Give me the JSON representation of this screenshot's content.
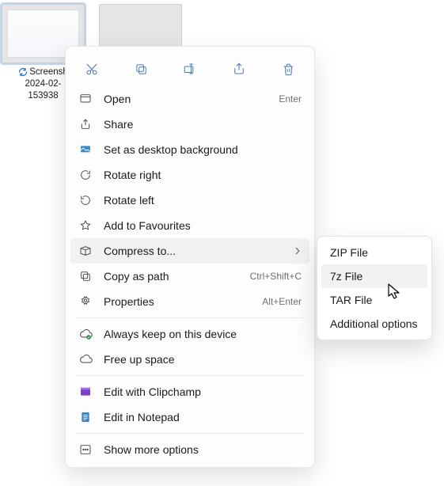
{
  "files": [
    {
      "name_line1": "Screensh",
      "name_line2": "2024-02-",
      "name_line3": "153938"
    },
    {
      "name_line1": ""
    }
  ],
  "toolbar_icons": [
    "cut",
    "copy",
    "rename",
    "share",
    "delete"
  ],
  "menu": {
    "open": {
      "label": "Open",
      "shortcut": "Enter"
    },
    "share": {
      "label": "Share"
    },
    "wallpaper": {
      "label": "Set as desktop background"
    },
    "rotright": {
      "label": "Rotate right"
    },
    "rotleft": {
      "label": "Rotate left"
    },
    "fav": {
      "label": "Add to Favourites"
    },
    "compress": {
      "label": "Compress to..."
    },
    "copypath": {
      "label": "Copy as path",
      "shortcut": "Ctrl+Shift+C"
    },
    "props": {
      "label": "Properties",
      "shortcut": "Alt+Enter"
    },
    "keep": {
      "label": "Always keep on this device"
    },
    "freeup": {
      "label": "Free up space"
    },
    "clipchamp": {
      "label": "Edit with Clipchamp"
    },
    "notepad": {
      "label": "Edit in Notepad"
    },
    "more": {
      "label": "Show more options"
    }
  },
  "submenu": {
    "zip": {
      "label": "ZIP File"
    },
    "7z": {
      "label": "7z File"
    },
    "tar": {
      "label": "TAR File"
    },
    "addl": {
      "label": "Additional options"
    }
  }
}
